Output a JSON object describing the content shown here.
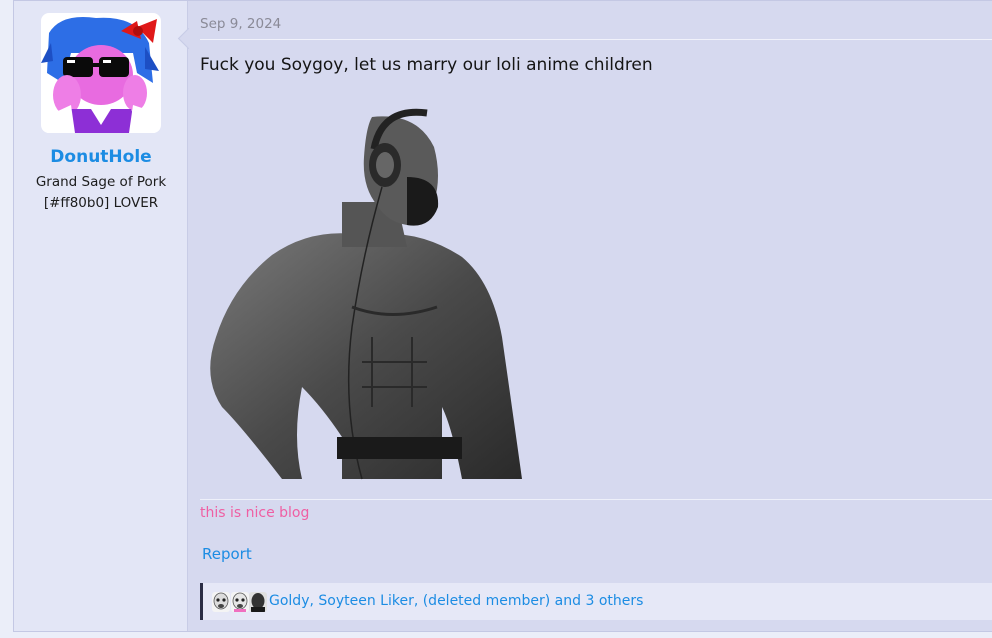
{
  "post": {
    "author": {
      "username": "DonutHole",
      "title": "Grand Sage of Pork",
      "title_line2": "[#ff80b0] LOVER",
      "avatar_icon": "anime-avatar-icon"
    },
    "date": "Sep 9, 2024",
    "message": "Fuck you Soygoy, let us marry our loli anime children",
    "image": {
      "icon": "gigachad-headphones-image"
    },
    "signature": "this is nice blog",
    "report_label": "Report",
    "reactions": {
      "text": "Goldy, Soyteen Liker, (deleted member) and 3 others",
      "icons": [
        "soyjak-face-icon",
        "soyjak-face-icon",
        "dark-face-icon"
      ]
    }
  },
  "colors": {
    "username": "#1c8ce3",
    "link": "#1c8ce3",
    "signature": "#ef5fa3",
    "post_bg": "#d6d9ef",
    "user_cell_bg": "#e3e6f6"
  }
}
